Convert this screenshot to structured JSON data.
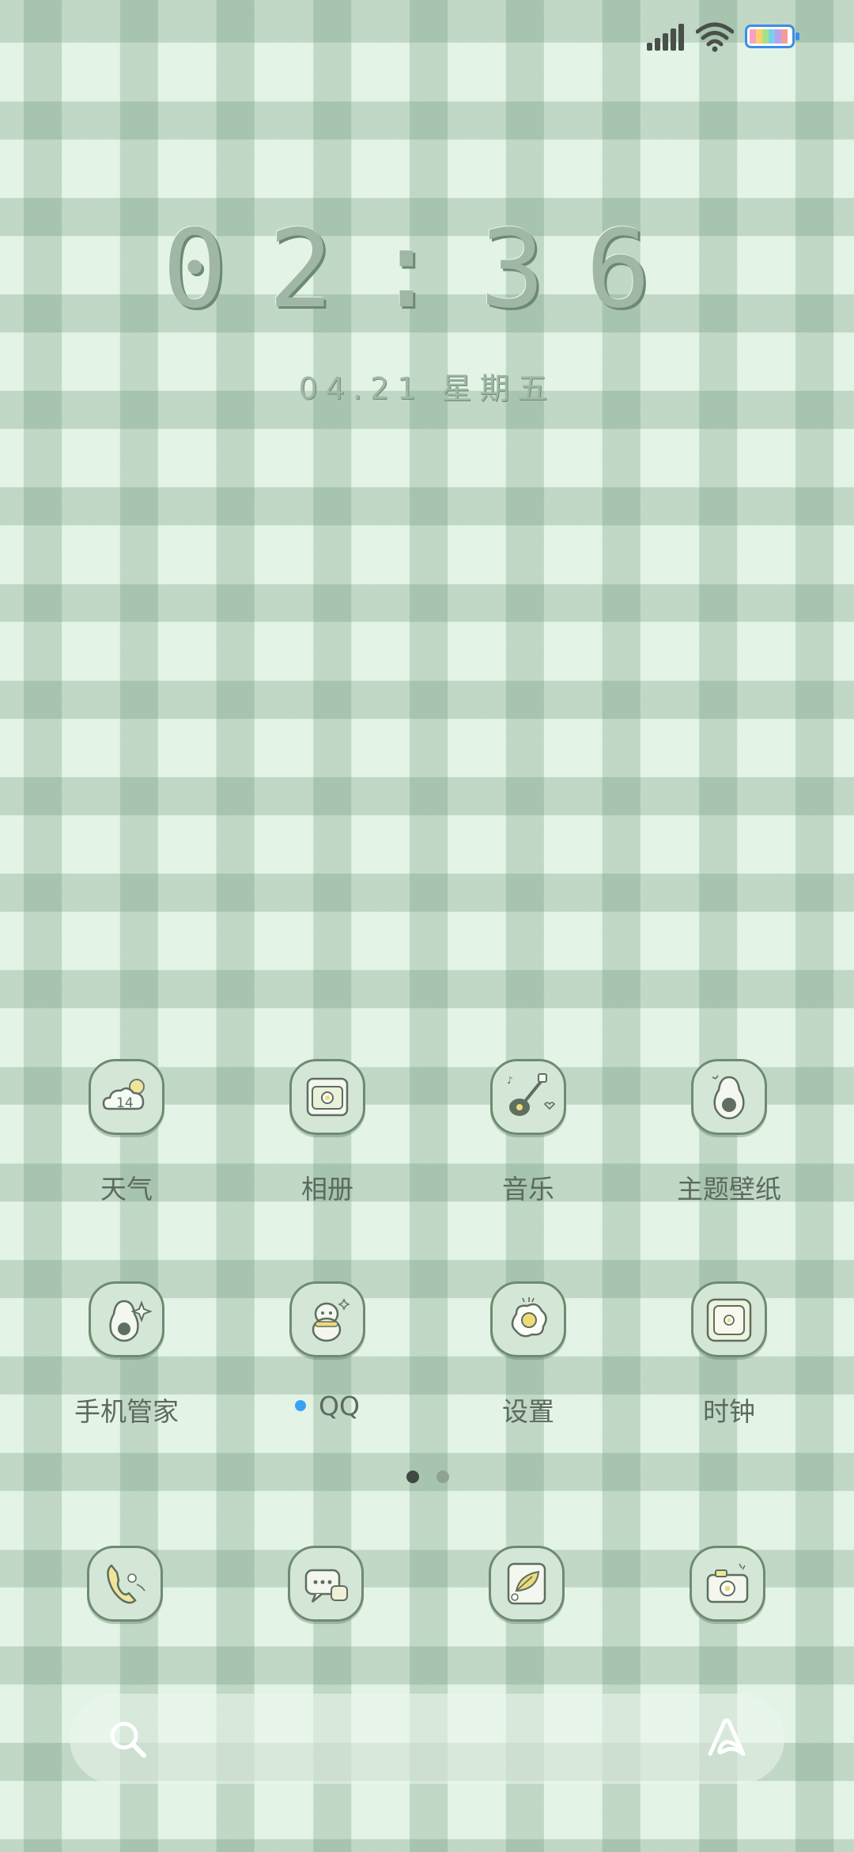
{
  "status_bar": {
    "signal_icon": "signal-bars-icon",
    "wifi_icon": "wifi-icon",
    "battery_icon": "battery-icon"
  },
  "lock_clock": {
    "time": "02:36",
    "date": "04.21 星期五"
  },
  "apps": [
    {
      "label": "天气",
      "icon": "weather-cloud-icon",
      "badge_text": "14"
    },
    {
      "label": "相册",
      "icon": "photo-album-icon"
    },
    {
      "label": "音乐",
      "icon": "music-guitar-icon"
    },
    {
      "label": "主题壁纸",
      "icon": "avocado-icon"
    },
    {
      "label": "手机管家",
      "icon": "avocado-sparkle-icon"
    },
    {
      "label": "QQ",
      "icon": "qq-penguin-icon",
      "has_notification_dot": true
    },
    {
      "label": "设置",
      "icon": "fried-egg-icon"
    },
    {
      "label": "时钟",
      "icon": "clock-frame-icon"
    }
  ],
  "page_indicator": {
    "pages": 2,
    "active_index": 0
  },
  "dock": [
    {
      "icon": "phone-icon"
    },
    {
      "icon": "messages-icon"
    },
    {
      "icon": "browser-leaf-icon"
    },
    {
      "icon": "camera-icon"
    }
  ],
  "search_bar": {
    "search_icon": "search-icon",
    "assistant_icon": "assistant-a-icon"
  },
  "colors": {
    "background": "#e3f4e6",
    "plaid_stripe": "#6e9678",
    "icon_tile": "#d4e7d6",
    "icon_border": "#6e8b72",
    "label_text": "#5c6a5e",
    "clock_text": "#9fb7a4",
    "notification_dot": "#3aa1f4"
  }
}
